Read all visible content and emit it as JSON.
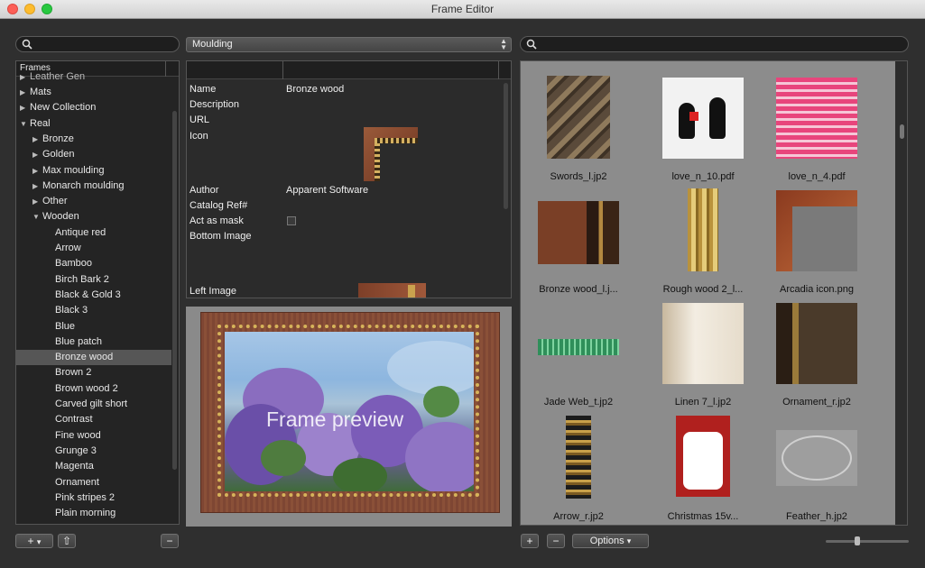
{
  "window": {
    "title": "Frame Editor"
  },
  "type_select": {
    "value": "Moulding"
  },
  "left": {
    "header": "Frames",
    "partial_top": "Leather Gen",
    "items": [
      {
        "label": "Mats",
        "level": 0,
        "expander": "▶"
      },
      {
        "label": "New Collection",
        "level": 0,
        "expander": "▶"
      },
      {
        "label": "Real",
        "level": 0,
        "expander": "▼"
      },
      {
        "label": "Bronze",
        "level": 1,
        "expander": "▶"
      },
      {
        "label": "Golden",
        "level": 1,
        "expander": "▶"
      },
      {
        "label": "Max moulding",
        "level": 1,
        "expander": "▶"
      },
      {
        "label": "Monarch moulding",
        "level": 1,
        "expander": "▶"
      },
      {
        "label": "Other",
        "level": 1,
        "expander": "▶"
      },
      {
        "label": "Wooden",
        "level": 1,
        "expander": "▼"
      },
      {
        "label": "Antique red",
        "level": 2,
        "expander": ""
      },
      {
        "label": "Arrow",
        "level": 2,
        "expander": ""
      },
      {
        "label": "Bamboo",
        "level": 2,
        "expander": ""
      },
      {
        "label": "Birch Bark 2",
        "level": 2,
        "expander": ""
      },
      {
        "label": "Black & Gold 3",
        "level": 2,
        "expander": ""
      },
      {
        "label": "Black 3",
        "level": 2,
        "expander": ""
      },
      {
        "label": "Blue",
        "level": 2,
        "expander": ""
      },
      {
        "label": "Blue patch",
        "level": 2,
        "expander": ""
      },
      {
        "label": "Bronze wood",
        "level": 2,
        "expander": "",
        "selected": true
      },
      {
        "label": "Brown 2",
        "level": 2,
        "expander": ""
      },
      {
        "label": "Brown wood 2",
        "level": 2,
        "expander": ""
      },
      {
        "label": "Carved gilt short",
        "level": 2,
        "expander": ""
      },
      {
        "label": "Contrast",
        "level": 2,
        "expander": ""
      },
      {
        "label": "Fine wood",
        "level": 2,
        "expander": ""
      },
      {
        "label": "Grunge 3",
        "level": 2,
        "expander": ""
      },
      {
        "label": "Magenta",
        "level": 2,
        "expander": ""
      },
      {
        "label": "Ornament",
        "level": 2,
        "expander": ""
      },
      {
        "label": "Pink stripes 2",
        "level": 2,
        "expander": ""
      },
      {
        "label": "Plain morning",
        "level": 2,
        "expander": ""
      }
    ]
  },
  "properties": {
    "name_label": "Name",
    "name_value": "Bronze wood",
    "description_label": "Description",
    "url_label": "URL",
    "icon_label": "Icon",
    "author_label": "Author",
    "author_value": "Apparent Software",
    "catalog_label": "Catalog Ref#",
    "mask_label": "Act as mask",
    "bottom_label": "Bottom Image",
    "left_label": "Left Image"
  },
  "preview": {
    "text": "Frame preview"
  },
  "library": {
    "items": [
      {
        "caption": "Swords_l.jp2",
        "icon": "swords-moulding-thumbnail"
      },
      {
        "caption": "love_n_10.pdf",
        "icon": "cats-love-thumbnail"
      },
      {
        "caption": "love_n_4.pdf",
        "icon": "pink-stripes-thumbnail"
      },
      {
        "caption": "Bronze wood_l.j...",
        "icon": "bronze-wood-thumbnail"
      },
      {
        "caption": "Rough wood 2_l...",
        "icon": "rough-wood-thumbnail"
      },
      {
        "caption": "Arcadia icon.png",
        "icon": "arcadia-corner-thumbnail"
      },
      {
        "caption": "Jade Web_t.jp2",
        "icon": "jade-web-thumbnail"
      },
      {
        "caption": "Linen 7_l.jp2",
        "icon": "linen-thumbnail"
      },
      {
        "caption": "Ornament_r.jp2",
        "icon": "ornament-thumbnail"
      },
      {
        "caption": "Arrow_r.jp2",
        "icon": "arrow-moulding-thumbnail"
      },
      {
        "caption": "Christmas 15v...",
        "icon": "christmas-card-thumbnail"
      },
      {
        "caption": "Feather_h.jp2",
        "icon": "feather-oval-thumbnail"
      }
    ]
  },
  "bottom": {
    "add": "+",
    "add_arrow": "▾",
    "share": "⇧",
    "remove": "−",
    "lib_add": "+",
    "lib_remove": "−",
    "options_label": "Options",
    "options_arrow": "▾"
  },
  "colors": {
    "selection": "#565656",
    "panel_bg": "#242424",
    "library_bg": "#8c8c8c"
  }
}
